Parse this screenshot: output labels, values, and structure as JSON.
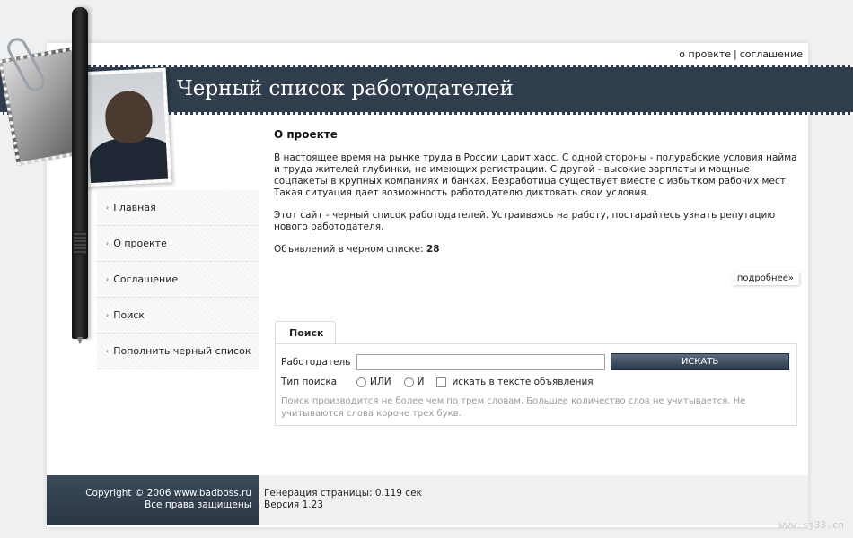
{
  "top_links": {
    "about": "о проекте",
    "separator": "|",
    "agreement": "соглашение"
  },
  "header": {
    "title": "Черный список работодателей"
  },
  "nav": {
    "items": [
      {
        "label": "Главная"
      },
      {
        "label": "О проекте"
      },
      {
        "label": "Соглашение"
      },
      {
        "label": "Поиск"
      },
      {
        "label": "Пополнить черный список"
      }
    ],
    "bullet": "›"
  },
  "main": {
    "heading": "О проекте",
    "paragraph1": "В настоящее время на рынке труда в России царит хаос. С одной стороны - полурабские условия найма и труда жителей глубинки, не имеющих регистрации. С другой - высокие зарплаты и мощные соцпакеты в крупных компаниях и банках. Безработица существует вместе с избытком рабочих мест. Такая ситуация дает возможность работодателю диктовать свои условия.",
    "paragraph2": "Этот сайт - черный список работодателей. Устраиваясь на работу, постарайтесь узнать репутацию нового работодателя.",
    "count_label": "Объявлений в черном списке: ",
    "count_value": "28",
    "more_link": "подробнее»"
  },
  "search": {
    "tab_label": "Поиск",
    "employer_label": "Работодатель",
    "employer_value": "",
    "button_label": "ИСКАТЬ",
    "type_label": "Тип поиска",
    "option_or": "ИЛИ",
    "option_and": "И",
    "checkbox_label": "искать в тексте объявления",
    "hint": "Поиск производится не более чем по трем словам. Большее количество слов не учитывается. Не учитываются слова короче трех букв."
  },
  "footer": {
    "copyright": "Copyright © 2006 www.badboss.ru",
    "rights": "Все права защищены",
    "generation": "Генерация страницы: 0.119 сек",
    "version": "Версия 1.23"
  },
  "watermark": "www.sj33.cn",
  "colors": {
    "banner": "#2f3d4c",
    "button": "#2a3a4b",
    "footer": "#2a3644"
  }
}
